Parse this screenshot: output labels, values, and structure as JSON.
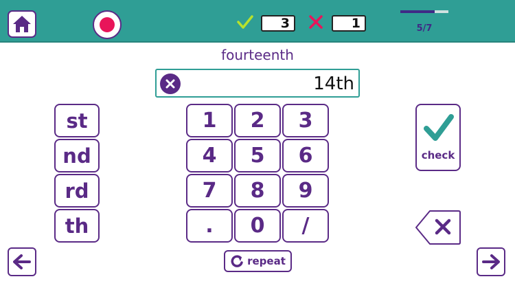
{
  "header": {
    "home_icon": "home-icon",
    "record_icon": "record-icon",
    "correct_icon": "checkmark-icon",
    "correct_count": "3",
    "wrong_icon": "cross-icon",
    "wrong_count": "1",
    "progress": {
      "current": 5,
      "total": 7,
      "label": "5/7"
    }
  },
  "prompt": {
    "word": "fourteenth"
  },
  "answer": {
    "value": "14th",
    "clear_icon": "clear-icon"
  },
  "suffix_keys": [
    "st",
    "nd",
    "rd",
    "th"
  ],
  "number_keys": [
    [
      "1",
      "2",
      "3"
    ],
    [
      "4",
      "5",
      "6"
    ],
    [
      "7",
      "8",
      "9"
    ],
    [
      ".",
      "0",
      "/"
    ]
  ],
  "check_button": {
    "label": "check",
    "icon": "checkmark-icon"
  },
  "backspace_icon": "backspace-icon",
  "repeat_button": {
    "label": "repeat",
    "icon": "repeat-icon"
  },
  "navigation": {
    "prev_icon": "arrow-left-icon",
    "next_icon": "arrow-right-icon"
  },
  "colors": {
    "header": "#2f9e95",
    "primary": "#5a2a86",
    "record": "#e8155a",
    "correct": "#9acd32",
    "wrong": "#e8155a",
    "accent": "#2f9e95"
  }
}
